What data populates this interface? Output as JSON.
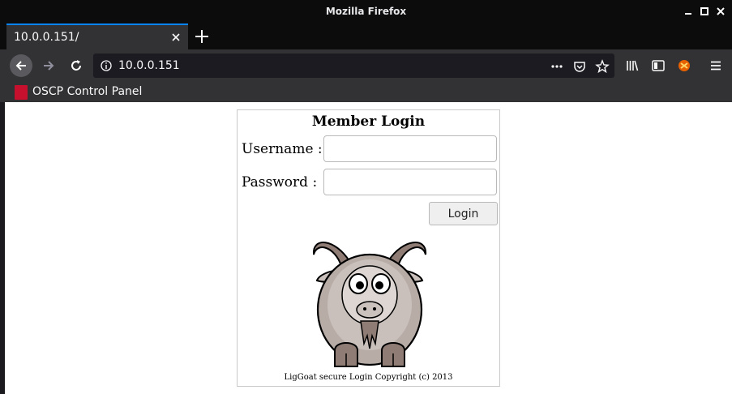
{
  "window": {
    "title": "Mozilla Firefox"
  },
  "tabs": [
    {
      "title": "10.0.0.151/"
    }
  ],
  "urlbar": {
    "value": "10.0.0.151"
  },
  "bookmarks": [
    {
      "label": "OSCP Control Panel"
    }
  ],
  "page": {
    "heading": "Member Login",
    "username_label": "Username :",
    "password_label": "Password  :",
    "login_button": "Login",
    "copyright": "LigGoat secure Login Copyright (c) 2013"
  },
  "icons": [
    "minimize-icon",
    "maximize-icon",
    "close-icon",
    "back-icon",
    "forward-icon",
    "reload-icon",
    "info-icon",
    "more-icon",
    "pocket-icon",
    "star-icon",
    "library-icon",
    "sidebar-icon",
    "extension-icon",
    "menu-icon",
    "goat-image"
  ]
}
